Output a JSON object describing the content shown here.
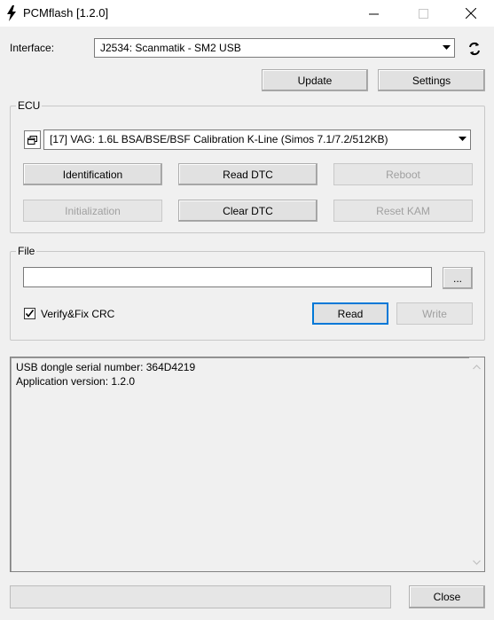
{
  "window": {
    "title": "PCMflash [1.2.0]"
  },
  "interface": {
    "label": "Interface:",
    "selected": "J2534: Scanmatik - SM2 USB"
  },
  "top_buttons": {
    "update": "Update",
    "settings": "Settings"
  },
  "ecu": {
    "group_title": "ECU",
    "selected": "[17] VAG: 1.6L BSA/BSE/BSF Calibration K-Line (Simos 7.1/7.2/512KB)",
    "buttons": {
      "identification": "Identification",
      "read_dtc": "Read DTC",
      "reboot": "Reboot",
      "initialization": "Initialization",
      "clear_dtc": "Clear DTC",
      "reset_kam": "Reset KAM"
    }
  },
  "file": {
    "group_title": "File",
    "path_value": "",
    "browse_label": "...",
    "verify_label": "Verify&Fix CRC",
    "verify_checked": true,
    "read_label": "Read",
    "write_label": "Write"
  },
  "log": {
    "lines": [
      "USB dongle serial number: 364D4219",
      "Application version: 1.2.0"
    ]
  },
  "progress": {
    "value": 0
  },
  "footer": {
    "close_label": "Close"
  },
  "icons": {
    "app": "lightning-icon",
    "refresh": "refresh-icon",
    "ecu_list": "window-list-icon"
  }
}
